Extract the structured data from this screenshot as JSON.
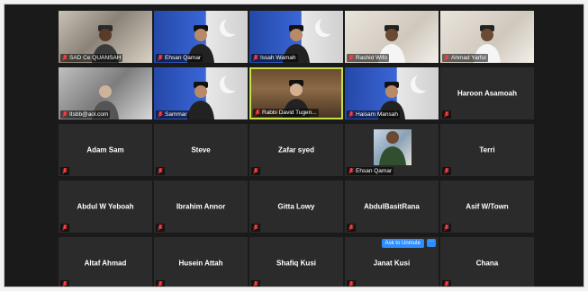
{
  "tiles": [
    {
      "name": "SAD Ce QUANSAH",
      "bg": "room",
      "mic": true
    },
    {
      "name": "Ehsan Qamar",
      "bg": "blue",
      "mic": true
    },
    {
      "name": "Issah Wamah",
      "bg": "blue",
      "mic": true
    },
    {
      "name": "Rashid Wifo",
      "bg": "light",
      "mic": true
    },
    {
      "name": "Ahmad Yarful",
      "bg": "light",
      "mic": true
    },
    {
      "name": "Itsbb@aol.com",
      "bg": "gray",
      "mic": true
    },
    {
      "name": "Sammar",
      "bg": "blue",
      "mic": true
    },
    {
      "name": "Rabbi David Tugen...",
      "bg": "books",
      "mic": true,
      "active": true
    },
    {
      "name": "Haisam Mansah",
      "bg": "blue",
      "mic": true
    },
    {
      "center": "Haroon Asamoah",
      "mic": true
    },
    {
      "center": "Adam Sam",
      "mic": true
    },
    {
      "center": "Steve",
      "mic": true
    },
    {
      "center": "Zafar syed",
      "mic": true
    },
    {
      "name": "Ehsan Qamar",
      "thumb": true,
      "mic": true
    },
    {
      "center": "Terri",
      "mic": true
    },
    {
      "center": "Abdul W Yeboah",
      "mic": true
    },
    {
      "center": "Ibrahim Annor",
      "mic": true
    },
    {
      "center": "Gitta Lowy",
      "mic": true
    },
    {
      "center": "AbdulBasitRana",
      "mic": true
    },
    {
      "center": "Asif W/Town",
      "mic": true
    },
    {
      "center": "Altaf Ahmad",
      "mic": true
    },
    {
      "center": "Husein Attah",
      "mic": true
    },
    {
      "center": "Shafiq Kusi",
      "mic": true
    },
    {
      "center": "Janat Kusi",
      "mic": true,
      "ask_unmute": "Ask to Unmute",
      "more": "···"
    },
    {
      "center": "Chana",
      "mic": true
    }
  ]
}
